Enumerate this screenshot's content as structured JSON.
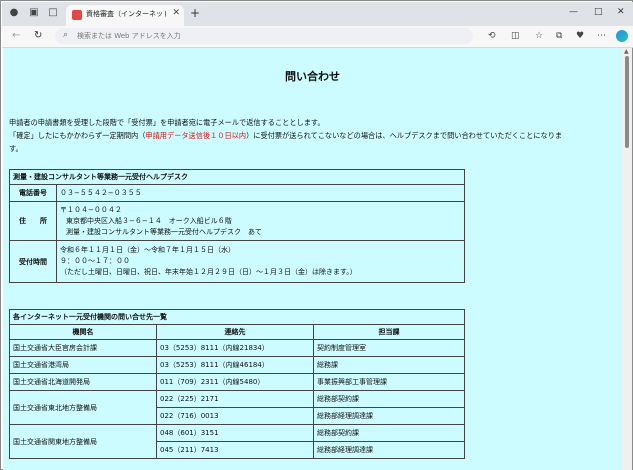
{
  "browser": {
    "tab_title": "資格審査（インターネット一元受付）",
    "address_placeholder": "検索または Web アドレスを入力"
  },
  "page": {
    "title": "問い合わせ",
    "intro1": "申請者の申請書類を受理した段階で「受付票」を申請者宛に電子メールで返信することとします。",
    "intro2_a": "「確定」したにもかかわらず一定期間内（",
    "intro2_red": "申請用データ送信後１０日以内",
    "intro2_b": "）に受付票が送られてこないなどの場合は、ヘルプデスクまで問い合わせていただくことになりま",
    "intro3": "す。"
  },
  "helpdesk": {
    "caption": "測量・建設コンサルタント等業務一元受付ヘルプデスク",
    "phone_label": "電話番号",
    "phone_value": "０３−５５４２−０３５５",
    "address_label": "住　　所",
    "address_line1": "〒１０４−００４２",
    "address_line2": "東京都中央区入船３−６−１４　オーク入船ビル６階",
    "address_line3": "測量・建設コンサルタント等業務一元受付ヘルプデスク　あて",
    "hours_label": "受付時間",
    "hours_line1": "令和６年１１月１日（金）〜令和７年１月１５日（水）",
    "hours_line2": "９：００〜１７：００",
    "hours_line3": "（ただし土曜日、日曜日、祝日、年末年始１２月２９日（日）〜１月３日（金）は除きます。）"
  },
  "contacts": {
    "caption": "各インターネット一元受付機関の問い合せ先一覧",
    "headers": [
      "機関名",
      "連絡先",
      "担当課"
    ],
    "rows": [
      {
        "org": "国土交通省大臣官房会計課",
        "phone": "03（5253）8111（内線21834）",
        "dept": "契約制度管理室"
      },
      {
        "org": "国土交通省港湾局",
        "phone": "03（5253）8111（内線46184）",
        "dept": "総務課"
      },
      {
        "org": "国土交通省北海道開発局",
        "phone": "011（709）2311（内線5480）",
        "dept": "事業振興部工事管理課"
      },
      {
        "org": "国土交通省東北地方整備局",
        "phone": "022（225）2171",
        "dept": "総務部契約課"
      },
      {
        "org": "",
        "phone": "022（716）0013",
        "dept": "総務部経理調達課"
      },
      {
        "org": "国土交通省関東地方整備局",
        "phone": "048（601）3151",
        "dept": "総務部契約課"
      },
      {
        "org": "",
        "phone": "045（211）7413",
        "dept": "総務部経理調達課"
      }
    ]
  }
}
